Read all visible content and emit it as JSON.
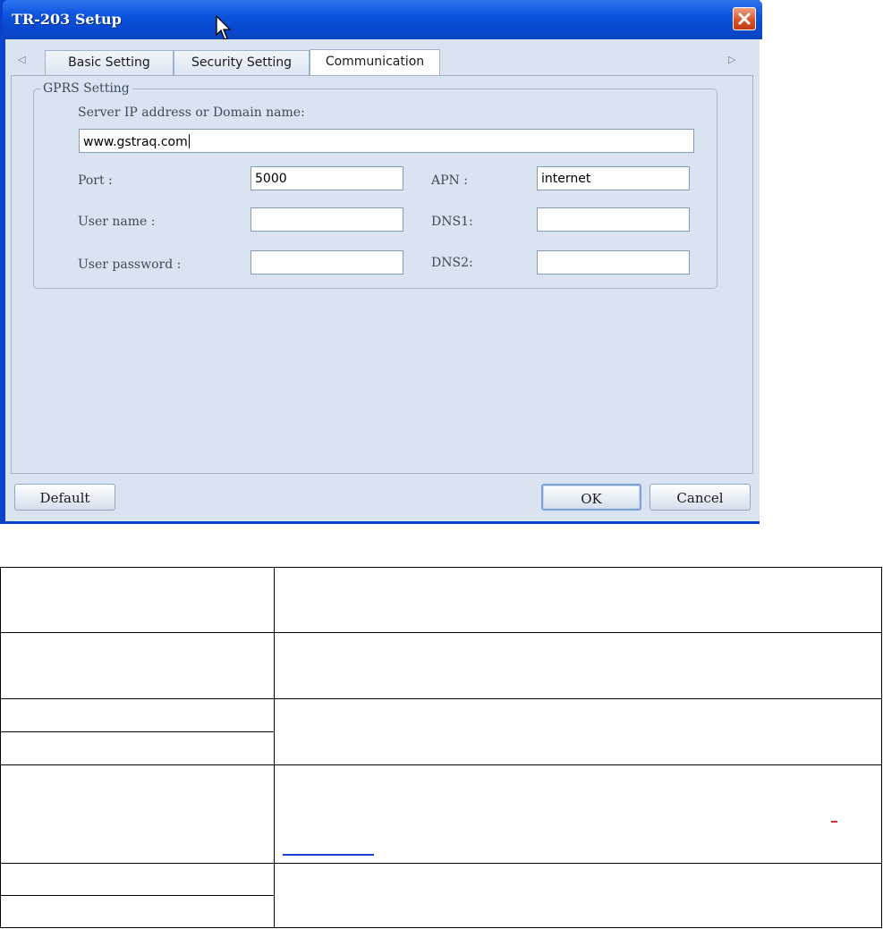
{
  "window": {
    "title": "TR-203 Setup",
    "close_icon": "close-icon",
    "cursor_icon": "arrow-cursor-icon"
  },
  "tabs": {
    "scroll_left": "◁",
    "scroll_right": "▷",
    "items": [
      {
        "label": "Basic Setting",
        "active": false
      },
      {
        "label": "Security Setting",
        "active": false
      },
      {
        "label": "Communication",
        "active": true
      }
    ]
  },
  "gprs": {
    "group_label": "GPRS Setting",
    "server_label": "Server IP address or Domain name:",
    "server_value": "www.gstraq.com",
    "port_label": "Port :",
    "port_value": "5000",
    "apn_label": "APN :",
    "apn_value": "internet",
    "username_label": "User name :",
    "username_value": "",
    "dns1_label": "DNS1:",
    "dns1_value": "",
    "password_label": "User password :",
    "password_value": "",
    "dns2_label": "DNS2:",
    "dns2_value": ""
  },
  "buttons": {
    "default": "Default",
    "ok": "OK",
    "cancel": "Cancel"
  },
  "colors": {
    "titlebar": "#0a43c9",
    "client_bg": "#dae4f0",
    "close": "#d8502a"
  }
}
